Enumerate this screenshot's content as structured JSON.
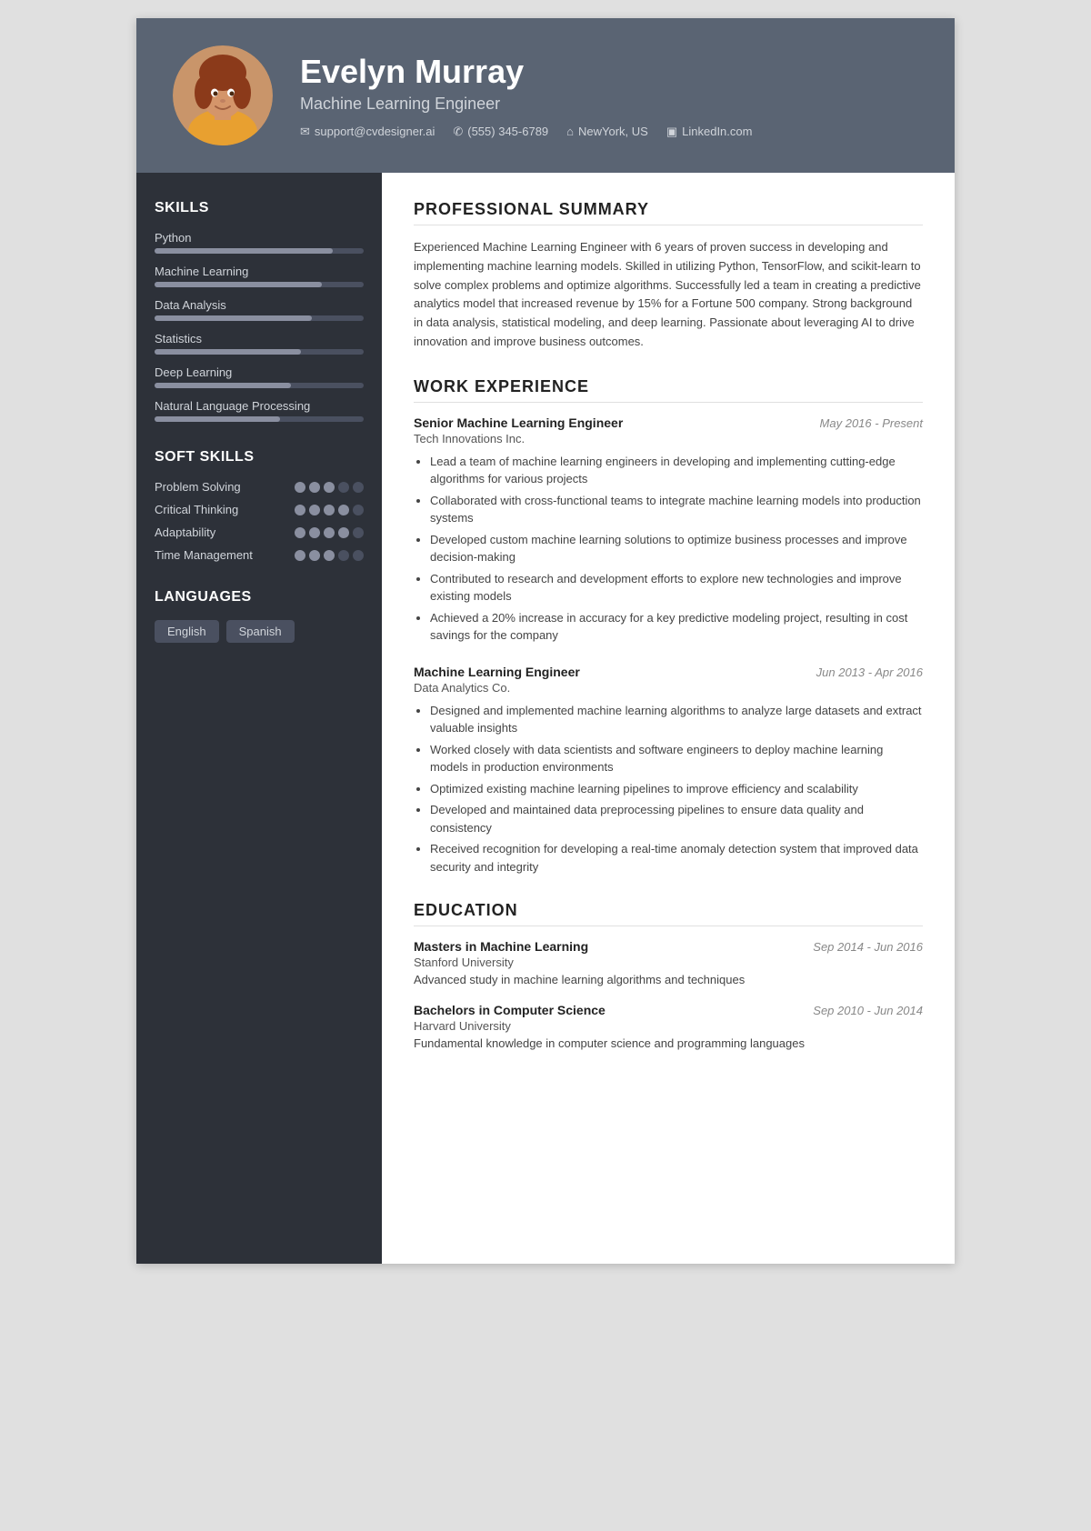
{
  "header": {
    "name": "Evelyn Murray",
    "title": "Machine Learning Engineer",
    "email": "support@cvdesigner.ai",
    "phone": "(555) 345-6789",
    "location": "NewYork, US",
    "linkedin": "LinkedIn.com"
  },
  "sidebar": {
    "skills_title": "SKILLS",
    "skills": [
      {
        "name": "Python",
        "percent": 85
      },
      {
        "name": "Machine Learning",
        "percent": 80
      },
      {
        "name": "Data Analysis",
        "percent": 75
      },
      {
        "name": "Statistics",
        "percent": 70
      },
      {
        "name": "Deep Learning",
        "percent": 65
      },
      {
        "name": "Natural Language Processing",
        "percent": 60
      }
    ],
    "soft_skills_title": "SOFT SKILLS",
    "soft_skills": [
      {
        "name": "Problem Solving",
        "filled": 3,
        "empty": 2
      },
      {
        "name": "Critical Thinking",
        "filled": 4,
        "empty": 1
      },
      {
        "name": "Adaptability",
        "filled": 4,
        "empty": 1
      },
      {
        "name": "Time Management",
        "filled": 3,
        "empty": 2
      }
    ],
    "languages_title": "LANGUAGES",
    "languages": [
      "English",
      "Spanish"
    ]
  },
  "main": {
    "summary_title": "PROFESSIONAL SUMMARY",
    "summary": "Experienced Machine Learning Engineer with 6 years of proven success in developing and implementing machine learning models. Skilled in utilizing Python, TensorFlow, and scikit-learn to solve complex problems and optimize algorithms. Successfully led a team in creating a predictive analytics model that increased revenue by 15% for a Fortune 500 company. Strong background in data analysis, statistical modeling, and deep learning. Passionate about leveraging AI to drive innovation and improve business outcomes.",
    "work_title": "WORK EXPERIENCE",
    "jobs": [
      {
        "title": "Senior Machine Learning Engineer",
        "date": "May 2016 - Present",
        "company": "Tech Innovations Inc.",
        "bullets": [
          "Lead a team of machine learning engineers in developing and implementing cutting-edge algorithms for various projects",
          "Collaborated with cross-functional teams to integrate machine learning models into production systems",
          "Developed custom machine learning solutions to optimize business processes and improve decision-making",
          "Contributed to research and development efforts to explore new technologies and improve existing models",
          "Achieved a 20% increase in accuracy for a key predictive modeling project, resulting in cost savings for the company"
        ]
      },
      {
        "title": "Machine Learning Engineer",
        "date": "Jun 2013 - Apr 2016",
        "company": "Data Analytics Co.",
        "bullets": [
          "Designed and implemented machine learning algorithms to analyze large datasets and extract valuable insights",
          "Worked closely with data scientists and software engineers to deploy machine learning models in production environments",
          "Optimized existing machine learning pipelines to improve efficiency and scalability",
          "Developed and maintained data preprocessing pipelines to ensure data quality and consistency",
          "Received recognition for developing a real-time anomaly detection system that improved data security and integrity"
        ]
      }
    ],
    "education_title": "EDUCATION",
    "education": [
      {
        "degree": "Masters in Machine Learning",
        "date": "Sep 2014 - Jun 2016",
        "school": "Stanford University",
        "desc": "Advanced study in machine learning algorithms and techniques"
      },
      {
        "degree": "Bachelors in Computer Science",
        "date": "Sep 2010 - Jun 2014",
        "school": "Harvard University",
        "desc": "Fundamental knowledge in computer science and programming languages"
      }
    ]
  }
}
